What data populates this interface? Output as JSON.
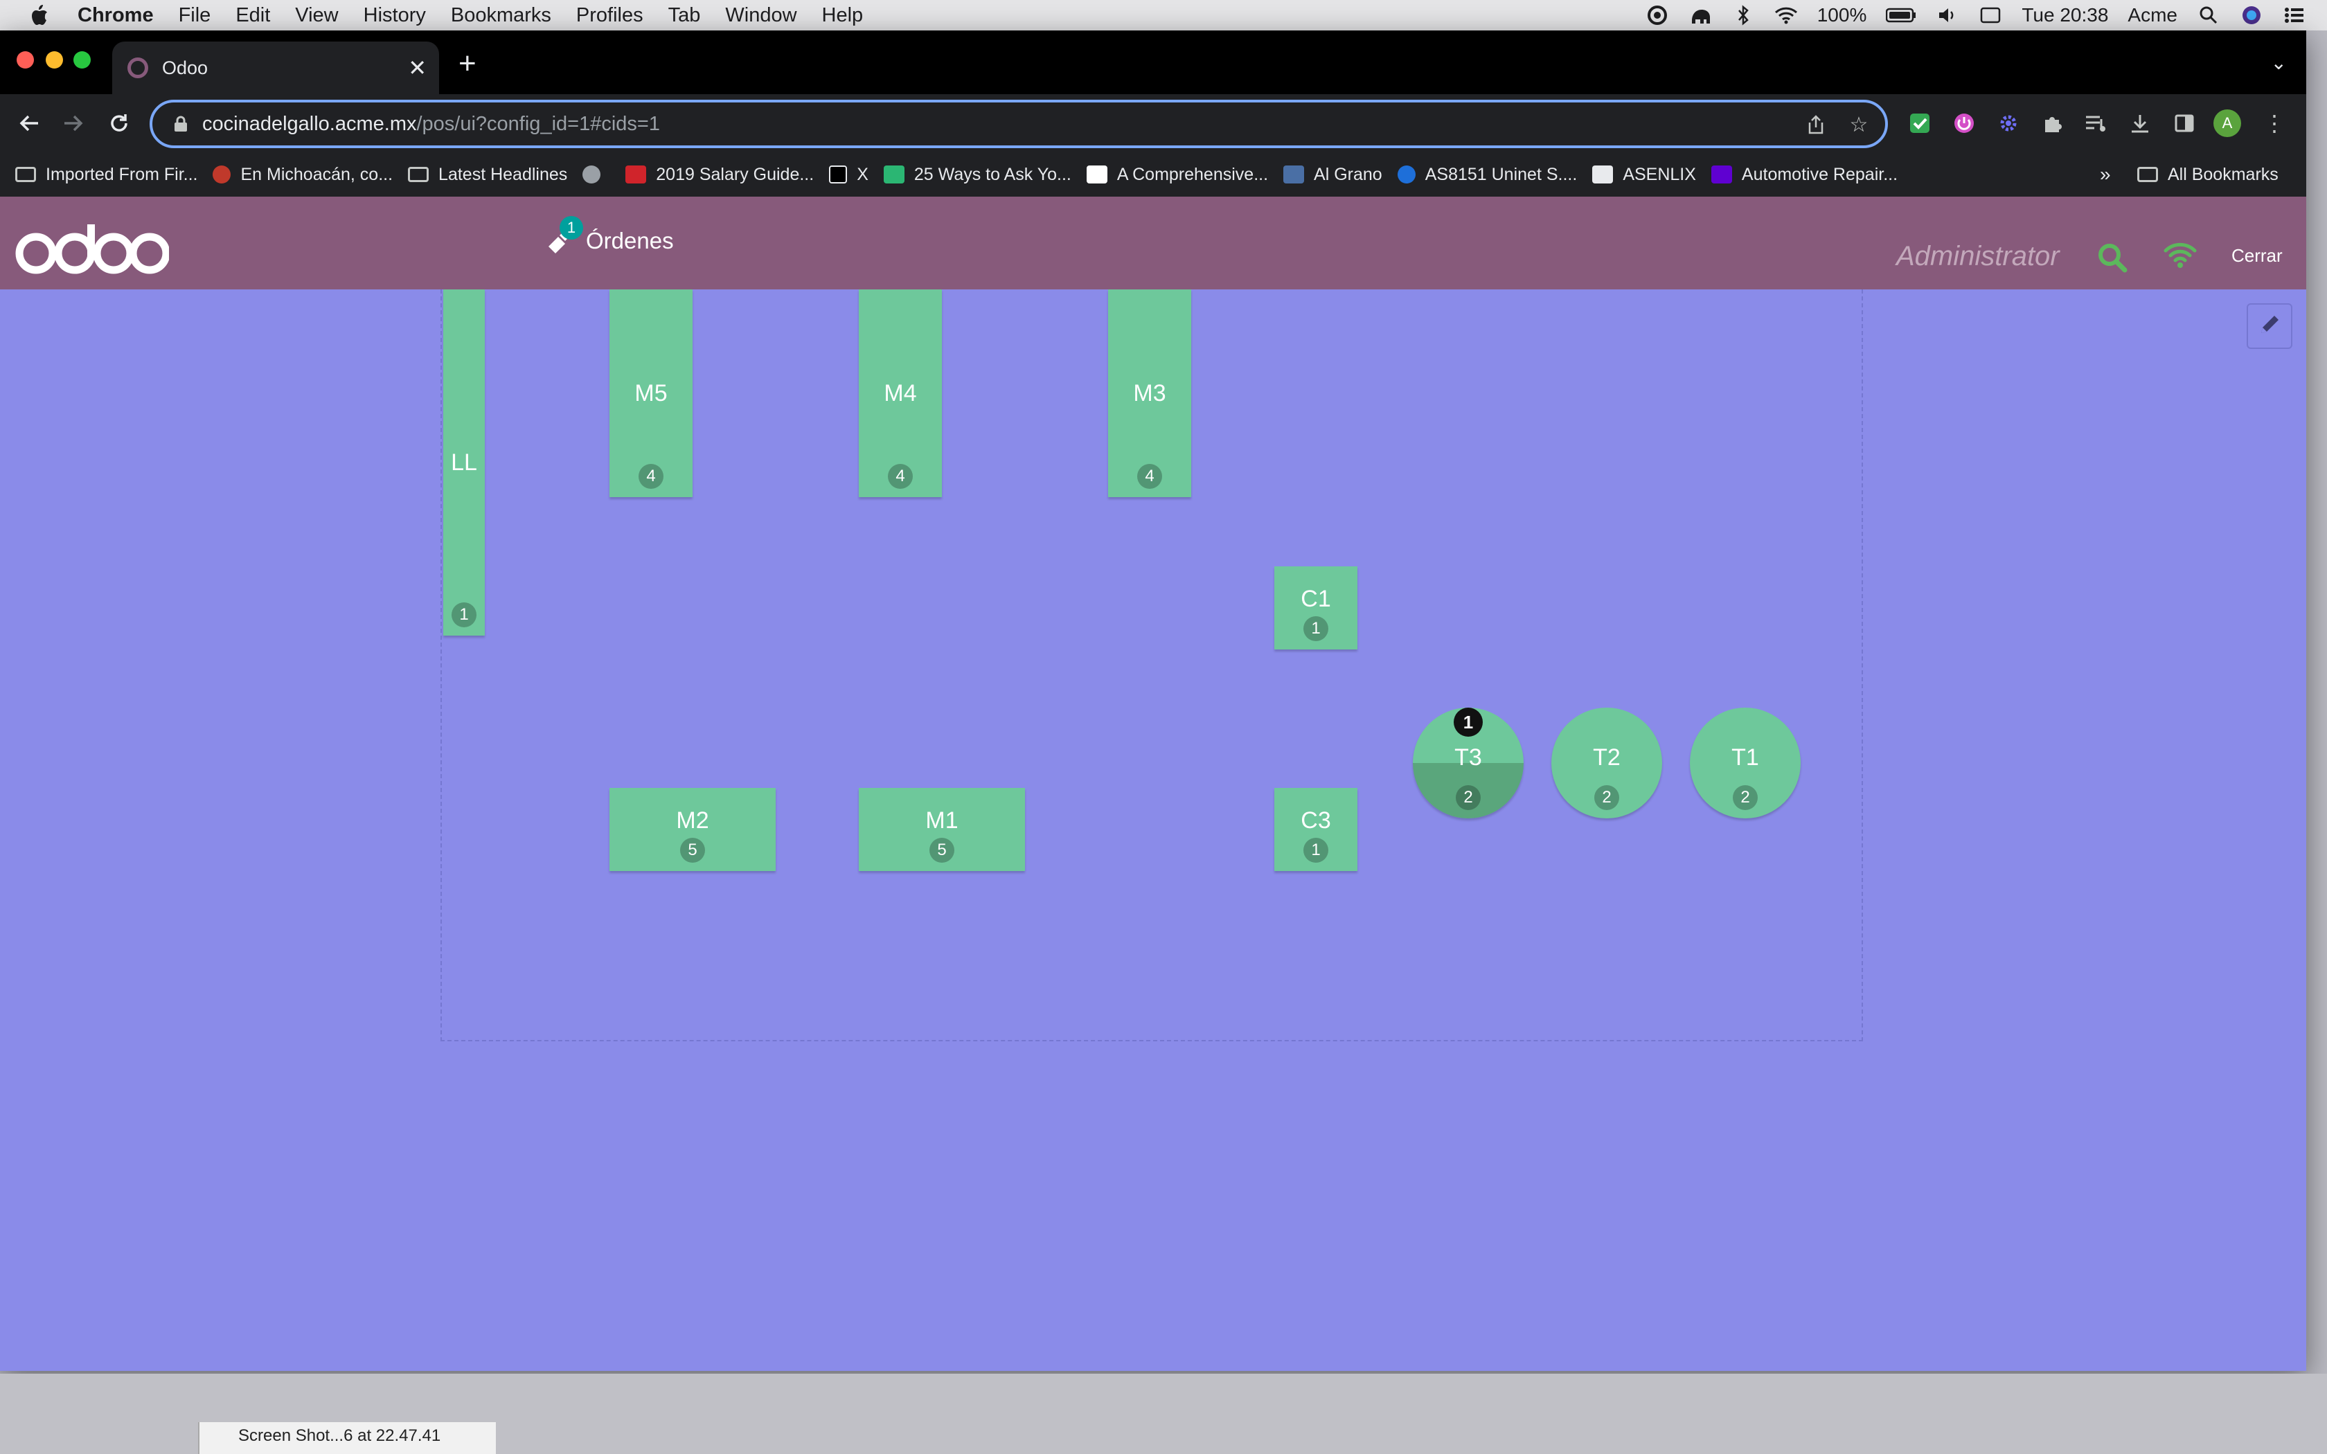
{
  "menubar": {
    "app": "Chrome",
    "items": [
      "File",
      "Edit",
      "View",
      "History",
      "Bookmarks",
      "Profiles",
      "Tab",
      "Window",
      "Help"
    ],
    "battery": "100%",
    "clock": "Tue 20:38",
    "user": "Acme"
  },
  "browser": {
    "tab_title": "Odoo",
    "url_host": "cocinadelgallo.acme.mx",
    "url_path": "/pos/ui?config_id=1#cids=1",
    "profile_initial": "A",
    "bookmarks": [
      "Imported From Fir...",
      "En Michoacán, co...",
      "Latest Headlines",
      "2019 Salary Guide...",
      "X",
      "25 Ways to Ask Yo...",
      "A Comprehensive...",
      "Al Grano",
      "AS8151 Uninet S....",
      "ASENLIX",
      "Automotive Repair..."
    ],
    "overflow": "»",
    "all_bookmarks": "All Bookmarks"
  },
  "odoo": {
    "orders_label": "Órdenes",
    "orders_count": "1",
    "user": "Administrator",
    "close_label": "Cerrar"
  },
  "tables": [
    {
      "name": "LL",
      "seats": "1"
    },
    {
      "name": "M5",
      "seats": "4"
    },
    {
      "name": "M4",
      "seats": "4"
    },
    {
      "name": "M3",
      "seats": "4"
    },
    {
      "name": "C1",
      "seats": "1"
    },
    {
      "name": "T3",
      "seats": "2",
      "orders": "1"
    },
    {
      "name": "T2",
      "seats": "2"
    },
    {
      "name": "T1",
      "seats": "2"
    },
    {
      "name": "M2",
      "seats": "5"
    },
    {
      "name": "M1",
      "seats": "5"
    },
    {
      "name": "C3",
      "seats": "1"
    }
  ],
  "colors": {
    "odoo_purple": "#875a7b",
    "floor_bg": "#8a8be9",
    "table_green": "#6ec89b"
  },
  "finder": {
    "item": "Screen Shot...6 at 22.47.41"
  }
}
